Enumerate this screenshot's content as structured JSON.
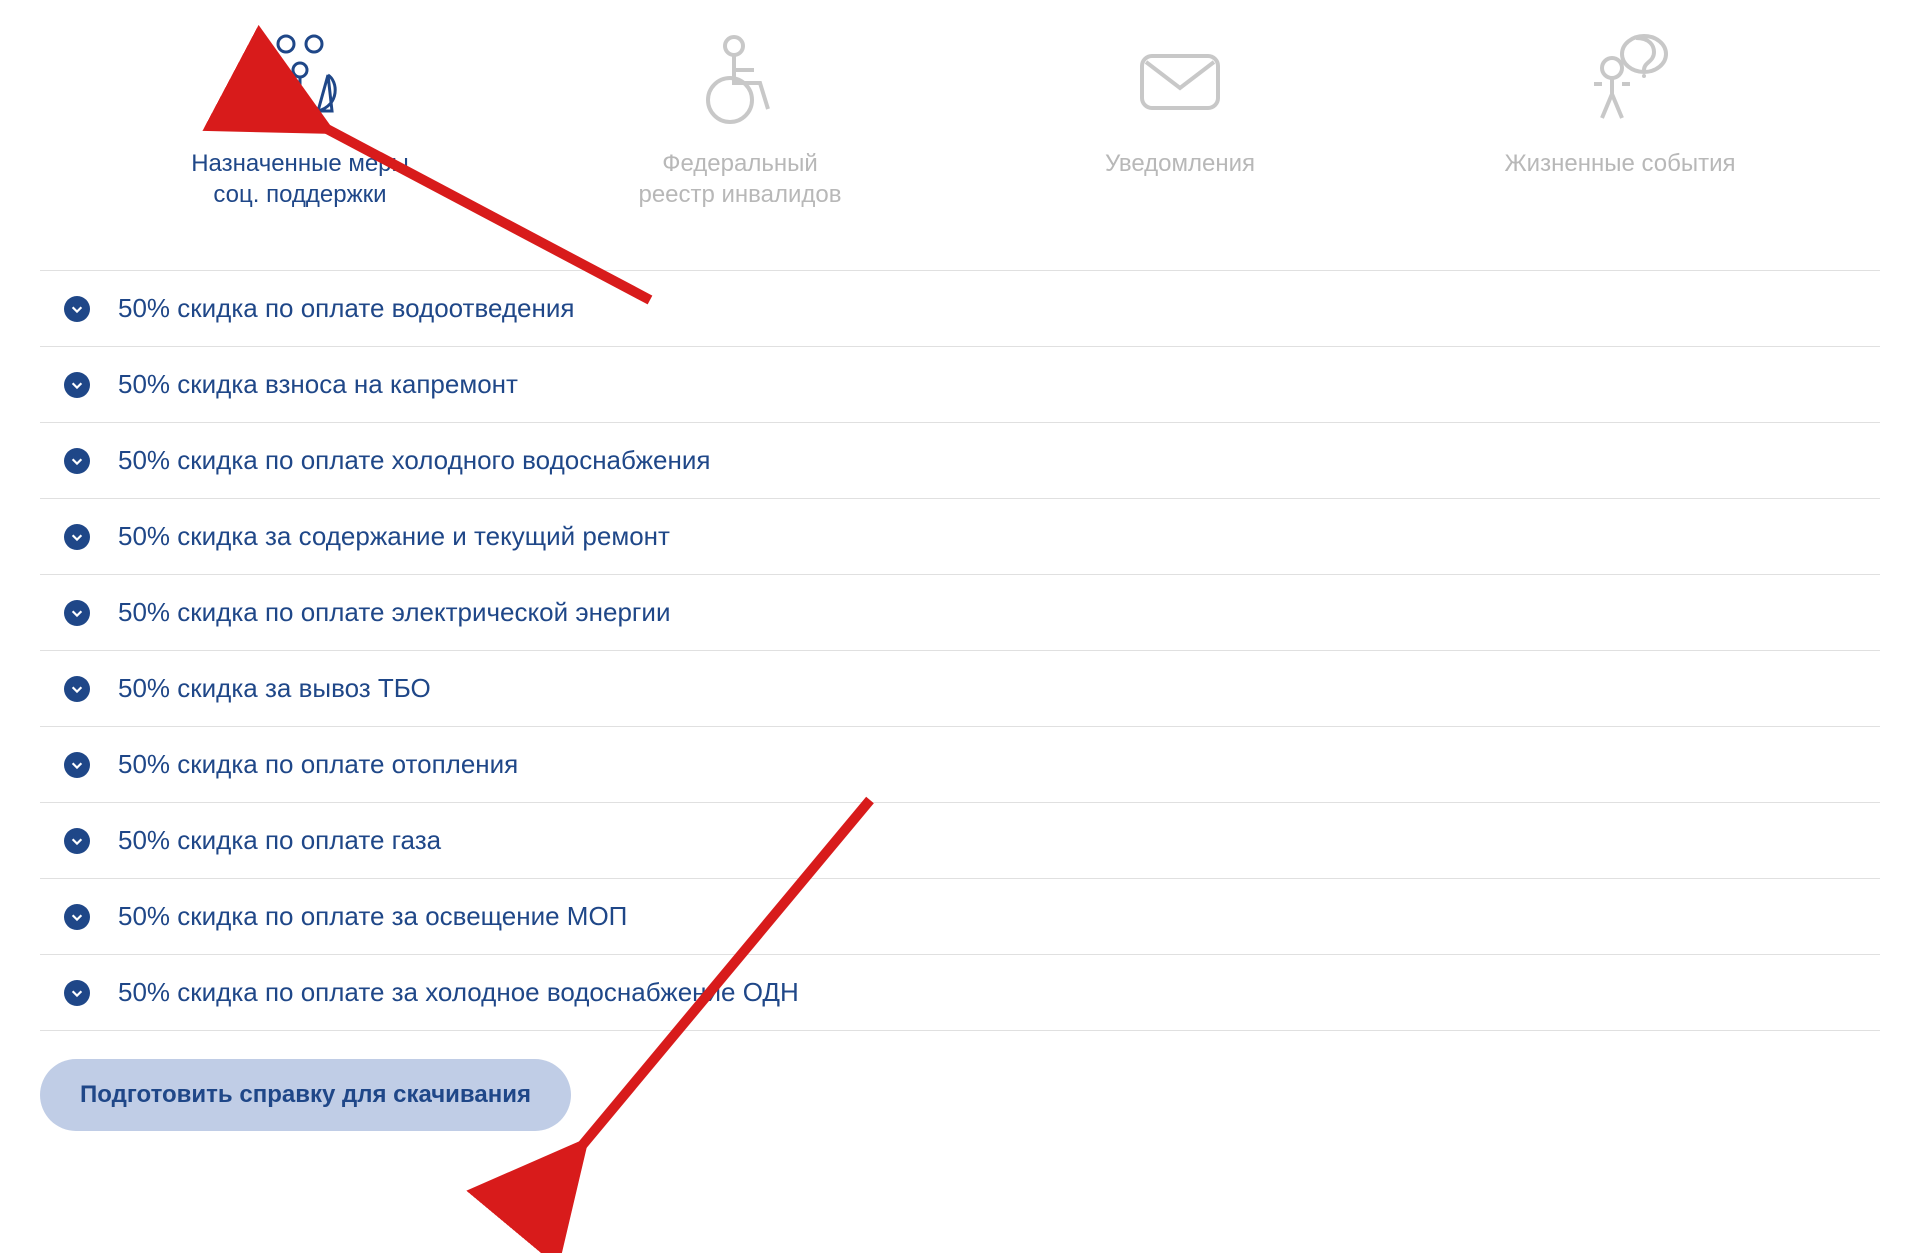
{
  "tabs": [
    {
      "label": "Назначенные меры\nсоц. поддержки",
      "active": true,
      "icon": "family-support-icon"
    },
    {
      "label": "Федеральный\nреестр инвалидов",
      "active": false,
      "icon": "wheelchair-icon"
    },
    {
      "label": "Уведомления",
      "active": false,
      "icon": "envelope-icon"
    },
    {
      "label": "Жизненные события",
      "active": false,
      "icon": "question-person-icon"
    }
  ],
  "items": [
    {
      "text": "50% скидка по оплате водоотведения"
    },
    {
      "text": "50% скидка взноса на капремонт"
    },
    {
      "text": "50% скидка по оплате холодного водоснабжения"
    },
    {
      "text": "50% скидка за содержание и текущий ремонт"
    },
    {
      "text": "50% скидка по оплате электрической энергии"
    },
    {
      "text": "50% скидка за вывоз ТБО"
    },
    {
      "text": "50% скидка по оплате отопления"
    },
    {
      "text": "50% скидка по оплате газа"
    },
    {
      "text": "50% скидка по оплате за освещение МОП"
    },
    {
      "text": "50% скидка по оплате за холодное водоснабжение ОДН"
    }
  ],
  "actions": {
    "download_label": "Подготовить справку для скачивания"
  },
  "annotations": {
    "arrow_color": "#d81b1b"
  }
}
